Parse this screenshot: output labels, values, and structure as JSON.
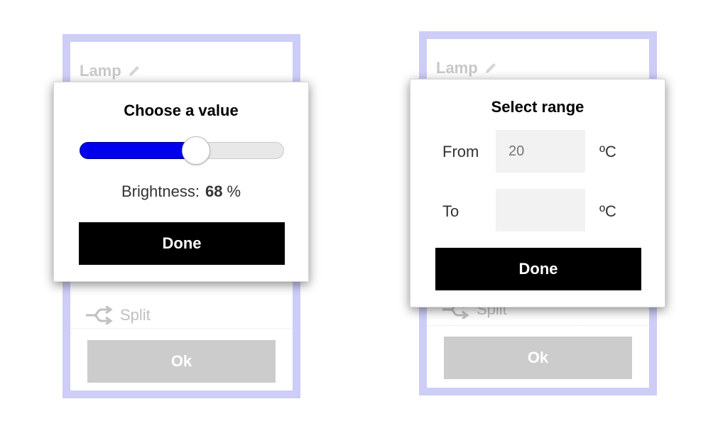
{
  "left_screen": {
    "panel_title": "Lamp",
    "split_label": "Split",
    "ok_label": "Ok",
    "dialog": {
      "title": "Choose a value",
      "slider_value_percent": 57,
      "readout_label": "Brightness:",
      "readout_value": "68",
      "readout_unit": "%",
      "done_label": "Done"
    }
  },
  "right_screen": {
    "panel_title": "Lamp",
    "split_label": "Split",
    "ok_label": "Ok",
    "dialog": {
      "title": "Select range",
      "from_label": "From",
      "from_placeholder": "20",
      "from_unit": "ºC",
      "to_label": "To",
      "to_value": "",
      "to_unit": "ºC",
      "done_label": "Done"
    }
  },
  "colors": {
    "panel_border": "#cdcdf8",
    "slider_fill": "#0000ee",
    "done_button": "#000000",
    "ok_button": "#cccccc"
  },
  "icons": {
    "edit": "pencil-icon",
    "split": "split-arrows-icon"
  }
}
